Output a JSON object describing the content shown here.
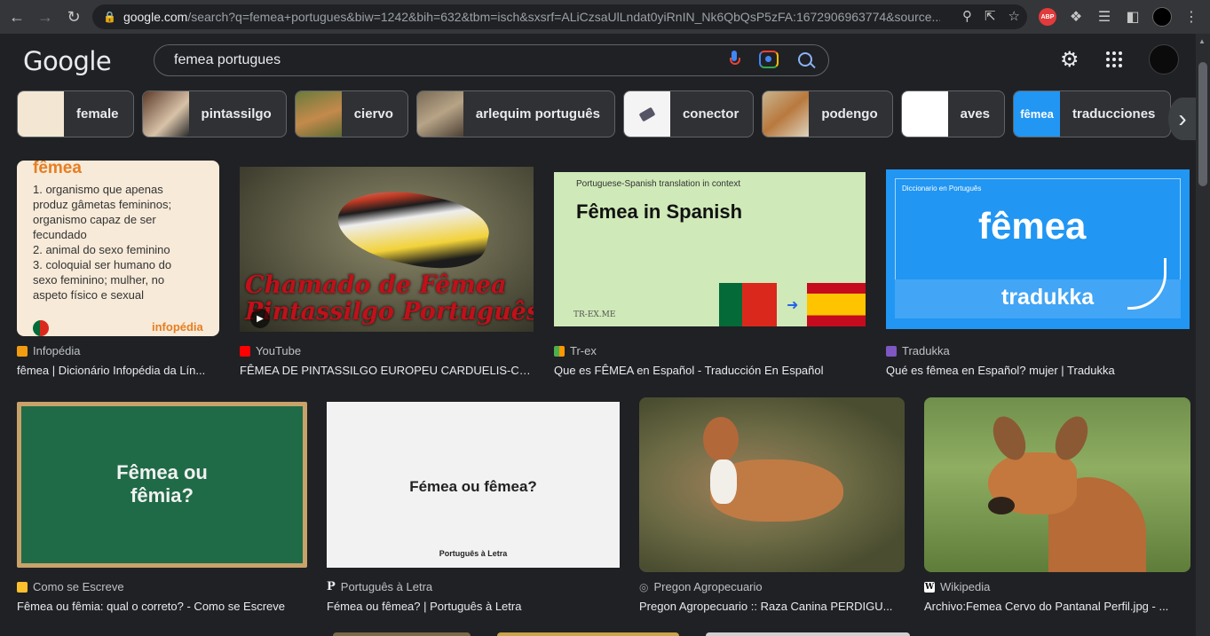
{
  "browser": {
    "url_host": "google.com",
    "url_rest": "/search?q=femea+portugues&biw=1242&bih=632&tbm=isch&sxsrf=ALiCzsaUlLndat0yiRnIN_Nk6QbQsP5zFA:1672906963774&source...",
    "abp_label": "ABP"
  },
  "header": {
    "logo": "Google",
    "query": "femea portugues"
  },
  "chips": [
    {
      "label": "female"
    },
    {
      "label": "pintassilgo"
    },
    {
      "label": "ciervo"
    },
    {
      "label": "arlequim português"
    },
    {
      "label": "conector"
    },
    {
      "label": "podengo"
    },
    {
      "label": "aves"
    },
    {
      "label": "traducciones",
      "thumb_text": "fêmea"
    }
  ],
  "results": [
    {
      "source": "Infopédia",
      "title": "fêmea | Dicionário Infopédia da Lín...",
      "img_heading": "fêmea",
      "img_lines": [
        "1. organismo que apenas",
        "produz gâmetas femininos;",
        "organismo capaz de ser",
        "fecundado",
        "2. animal do sexo feminino",
        "3. coloquial ser humano do",
        "sexo feminino; mulher, no",
        "aspeto físico e sexual"
      ],
      "img_brand": "infopédia"
    },
    {
      "source": "YouTube",
      "title": "FÊMEA DE PINTASSILGO EUROPEU CARDUELIS-CA...",
      "img_text1": "Chamado de Fêmea",
      "img_text2": "Pintassilgo Português"
    },
    {
      "source": "Tr-ex",
      "title": "Que es FÊMEA en Español - Traducción En Español",
      "img_small": "Portuguese-Spanish translation in context",
      "img_big": "Fêmea in Spanish",
      "img_brand": "TR-EX.ME"
    },
    {
      "source": "Tradukka",
      "title": "Qué es fêmea en Español? mujer | Tradukka",
      "img_small": "Diccionario en Português",
      "img_big": "fêmea",
      "img_brand": "tradukka"
    },
    {
      "source": "Como se Escreve",
      "title": "Fêmea ou fêmia: qual o correto? - Como se Escreve",
      "img_text1": "Fêmea ou",
      "img_text2": "fêmia?"
    },
    {
      "source": "Português à Letra",
      "title": "Fémea ou fêmea? | Português à Letra",
      "img_big": "Fémea ou fêmea?",
      "img_brand": "Português à Letra"
    },
    {
      "source": "Pregon Agropecuario",
      "title": "Pregon Agropecuario :: Raza Canina PERDIGU..."
    },
    {
      "source": "Wikipedia",
      "title": "Archivo:Femea Cervo do Pantanal Perfil.jpg - ..."
    }
  ],
  "colors": {
    "background": "#202124",
    "chrome": "#35363a",
    "text": "#e8eaed",
    "muted": "#bdc1c6",
    "link_blue": "#8ab4f8"
  }
}
